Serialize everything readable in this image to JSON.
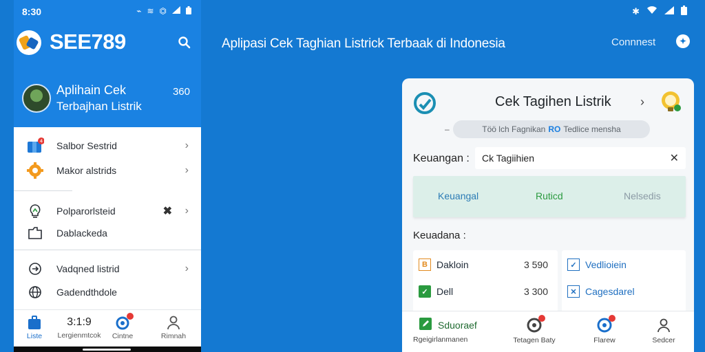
{
  "phone": {
    "status_time": "8:30",
    "brand": "SEE789",
    "profile": {
      "line1": "Aplihain Cek",
      "line2": "Terbajhan Listrik",
      "number": "360"
    },
    "menu": [
      {
        "label": "Salbor Sestrid",
        "icon": "bag-icon"
      },
      {
        "label": "Makor alstrids",
        "icon": "gear-icon"
      },
      {
        "label": "Polparorlsteid",
        "icon": "bulb-icon"
      },
      {
        "label": "Dablackeda",
        "icon": "folder-icon"
      },
      {
        "label": "Vadqned listrid",
        "icon": "sync-icon"
      },
      {
        "label": "Gadendthdole",
        "icon": "globe-icon"
      }
    ],
    "nav": [
      {
        "label": "Liste",
        "icon": "home-bag-icon"
      },
      {
        "label": "Lergienmtcok",
        "value": "3:1:9"
      },
      {
        "label": "Cintne",
        "icon": "refresh-icon"
      },
      {
        "label": "Rimnah",
        "icon": "user-icon"
      }
    ]
  },
  "header": {
    "headline": "Aplipasi Cek Taghian Listrick Terbaak di Indonesia",
    "connect": "Connnest"
  },
  "card": {
    "title": "Cek Tagihen Listrik",
    "pill_before": "Töö lch Fagnikan",
    "pill_highlight": "RO",
    "pill_after": "Tedlice mensha",
    "field_label": "Keuangan :",
    "field_value": "Ck Tagiihien",
    "tabs": [
      "Keuangal",
      "Ruticd",
      "Nelsedis"
    ],
    "section_label": "Keuadana :",
    "left_rows": [
      {
        "label": "Dakloin",
        "value": "3 590"
      },
      {
        "label": "Dell",
        "value": "3 300"
      }
    ],
    "right_rows": [
      {
        "label": "Vedlioiein"
      },
      {
        "label": "Cagesdarel"
      }
    ],
    "nav": [
      {
        "label": "Rgeigirlanmanen",
        "title": "Sduoraef"
      },
      {
        "label": "Tetagen Baty"
      },
      {
        "label": "Flarew"
      },
      {
        "label": "Sedcer"
      }
    ]
  },
  "colors": {
    "background": "#1479d2",
    "header_blue": "#1a82e2",
    "accent_green": "#2a9a3f",
    "tab_band": "#dcefe9"
  }
}
